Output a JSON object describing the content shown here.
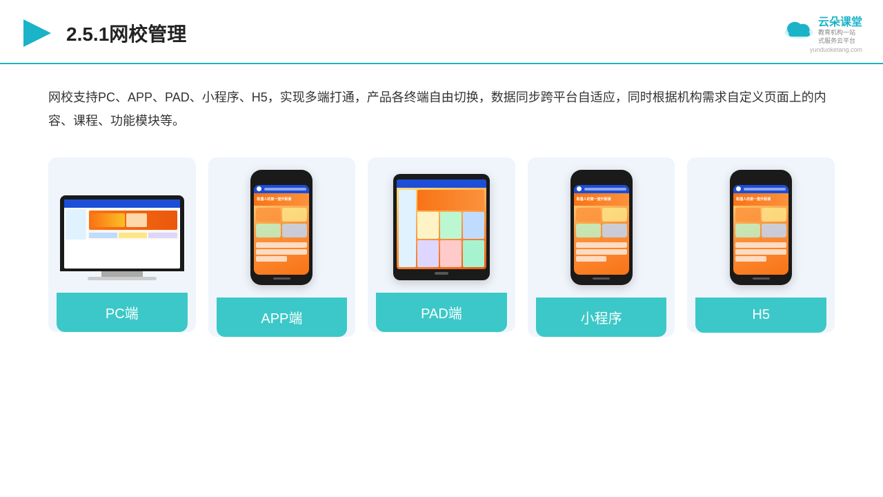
{
  "header": {
    "title": "2.5.1网校管理",
    "logo_brand": "云朵课堂",
    "logo_slogan": "教育机构一站\n式服务云平台",
    "logo_url": "yunduoketang.com"
  },
  "description": "网校支持PC、APP、PAD、小程序、H5，实现多端打通，产品各终端自由切换，数据同步跨平台自适应，同时根据机构需求自定义页面上的内容、课程、功能模块等。",
  "cards": [
    {
      "id": "pc",
      "label": "PC端"
    },
    {
      "id": "app",
      "label": "APP端"
    },
    {
      "id": "pad",
      "label": "PAD端"
    },
    {
      "id": "mini",
      "label": "小程序"
    },
    {
      "id": "h5",
      "label": "H5"
    }
  ],
  "accent_color": "#3cc8c8"
}
